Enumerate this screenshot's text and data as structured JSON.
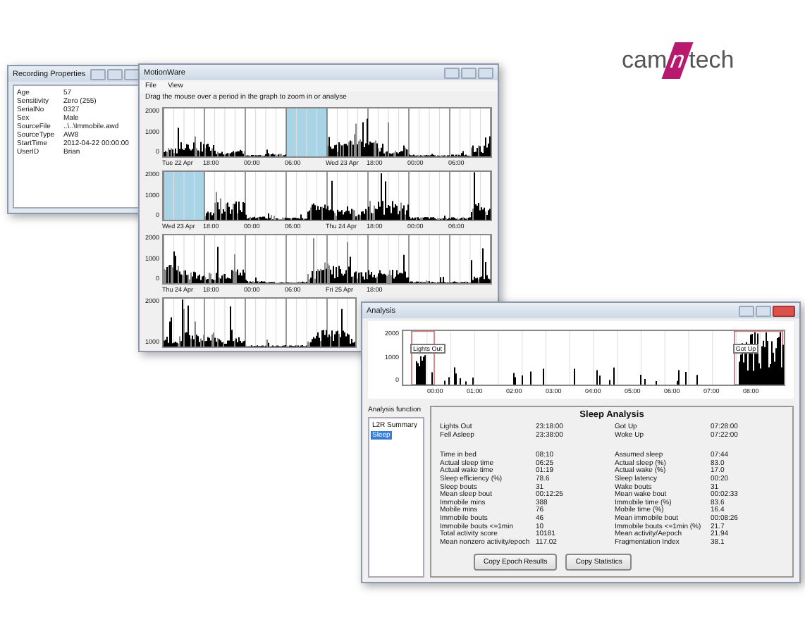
{
  "logo": {
    "left": "cam",
    "mark": "n",
    "right": "tech"
  },
  "properties_window": {
    "title": "Recording Properties",
    "rows": [
      {
        "label": "Age",
        "value": "57"
      },
      {
        "label": "Sensitivity",
        "value": "Zero (255)"
      },
      {
        "label": "SerialNo",
        "value": "0327"
      },
      {
        "label": "Sex",
        "value": "Male"
      },
      {
        "label": "SourceFile",
        "value": "..\\..\\Immobile.awd"
      },
      {
        "label": "SourceType",
        "value": "AW8"
      },
      {
        "label": "StartTime",
        "value": "2012-04-22 00:00:00"
      },
      {
        "label": "UserID",
        "value": "Brian"
      }
    ]
  },
  "main_window": {
    "title": "MotionWare",
    "menu": [
      "File",
      "View"
    ],
    "instruction": "Drag the mouse over a period in the graph to zoom in or analyse",
    "rows": [
      {
        "y_ticks": [
          "2000",
          "1000",
          "0"
        ],
        "x_labels": [
          {
            "text": "Tue 22 Apr",
            "selected": false
          },
          {
            "text": "18:00",
            "selected": false
          },
          {
            "text": "00:00",
            "selected": false
          },
          {
            "text": "06:00",
            "selected": true
          },
          {
            "text": "Wed 23 Apr",
            "selected": false
          },
          {
            "text": "18:00",
            "selected": false
          },
          {
            "text": "00:00",
            "selected": false
          },
          {
            "text": "06:00",
            "selected": false
          }
        ]
      },
      {
        "y_ticks": [
          "2000",
          "1000",
          "0"
        ],
        "x_labels": [
          {
            "text": "Wed 23 Apr",
            "selected": true
          },
          {
            "text": "18:00",
            "selected": false
          },
          {
            "text": "00:00",
            "selected": false
          },
          {
            "text": "06:00",
            "selected": false
          },
          {
            "text": "Thu 24 Apr",
            "selected": false
          },
          {
            "text": "18:00",
            "selected": false
          },
          {
            "text": "00:00",
            "selected": false
          },
          {
            "text": "06:00",
            "selected": false
          }
        ]
      },
      {
        "y_ticks": [
          "2000",
          "1000",
          "0"
        ],
        "x_labels": [
          {
            "text": "Thu 24 Apr",
            "selected": false
          },
          {
            "text": "18:00",
            "selected": false
          },
          {
            "text": "00:00",
            "selected": false
          },
          {
            "text": "06:00",
            "selected": false
          },
          {
            "text": "Fri 25 Apr",
            "selected": false
          },
          {
            "text": "18:00",
            "selected": false
          }
        ]
      },
      {
        "y_ticks": [
          "2000",
          "1000"
        ],
        "x_labels": []
      }
    ]
  },
  "analysis_window": {
    "title": "Analysis",
    "y_ticks": [
      "2000",
      "1000",
      "0"
    ],
    "x_labels": [
      "00:00",
      "01:00",
      "02:00",
      "03:00",
      "04:00",
      "05:00",
      "06:00",
      "07:00",
      "08:00"
    ],
    "markers": [
      {
        "kind": "start",
        "text": "Lights Out"
      },
      {
        "kind": "end",
        "text": "Got Up"
      }
    ],
    "function_label": "Analysis function",
    "functions": [
      {
        "label": "L2R Summary",
        "selected": false
      },
      {
        "label": "Sleep",
        "selected": true
      }
    ],
    "panel_title": "Sleep Analysis",
    "times": [
      [
        "Lights Out",
        "23:18:00",
        "Got Up",
        "07:28:00"
      ],
      [
        "Fell Asleep",
        "23:38:00",
        "Woke Up",
        "07:22:00"
      ]
    ],
    "stats": [
      [
        "Time in bed",
        "08:10",
        "Assumed sleep",
        "07:44"
      ],
      [
        "Actual sleep time",
        "06:25",
        "Actual sleep (%)",
        "83.0"
      ],
      [
        "Actual wake time",
        "01:19",
        "Actual wake (%)",
        "17.0"
      ],
      [
        "Sleep efficiency (%)",
        "78.6",
        "Sleep latency",
        "00:20"
      ],
      [
        "Sleep bouts",
        "31",
        "Wake bouts",
        "31"
      ],
      [
        "Mean sleep bout",
        "00:12:25",
        "Mean wake bout",
        "00:02:33"
      ],
      [
        "Immobile mins",
        "388",
        "Immobile time (%)",
        "83.6"
      ],
      [
        "Mobile mins",
        "76",
        "Mobile time (%)",
        "16.4"
      ],
      [
        "Immobile bouts",
        "46",
        "Mean immobile bout",
        "00:08:26"
      ],
      [
        "Immobile bouts <=1min",
        "10",
        "Immobile bouts <=1min (%)",
        "21.7"
      ],
      [
        "Total activity score",
        "10181",
        "Mean activity/Aepoch",
        "21.94"
      ],
      [
        "Mean nonzero activity/epoch",
        "117.02",
        "Fragmentation Index",
        "38.1"
      ]
    ],
    "buttons": [
      "Copy Epoch Results",
      "Copy Statistics"
    ]
  }
}
